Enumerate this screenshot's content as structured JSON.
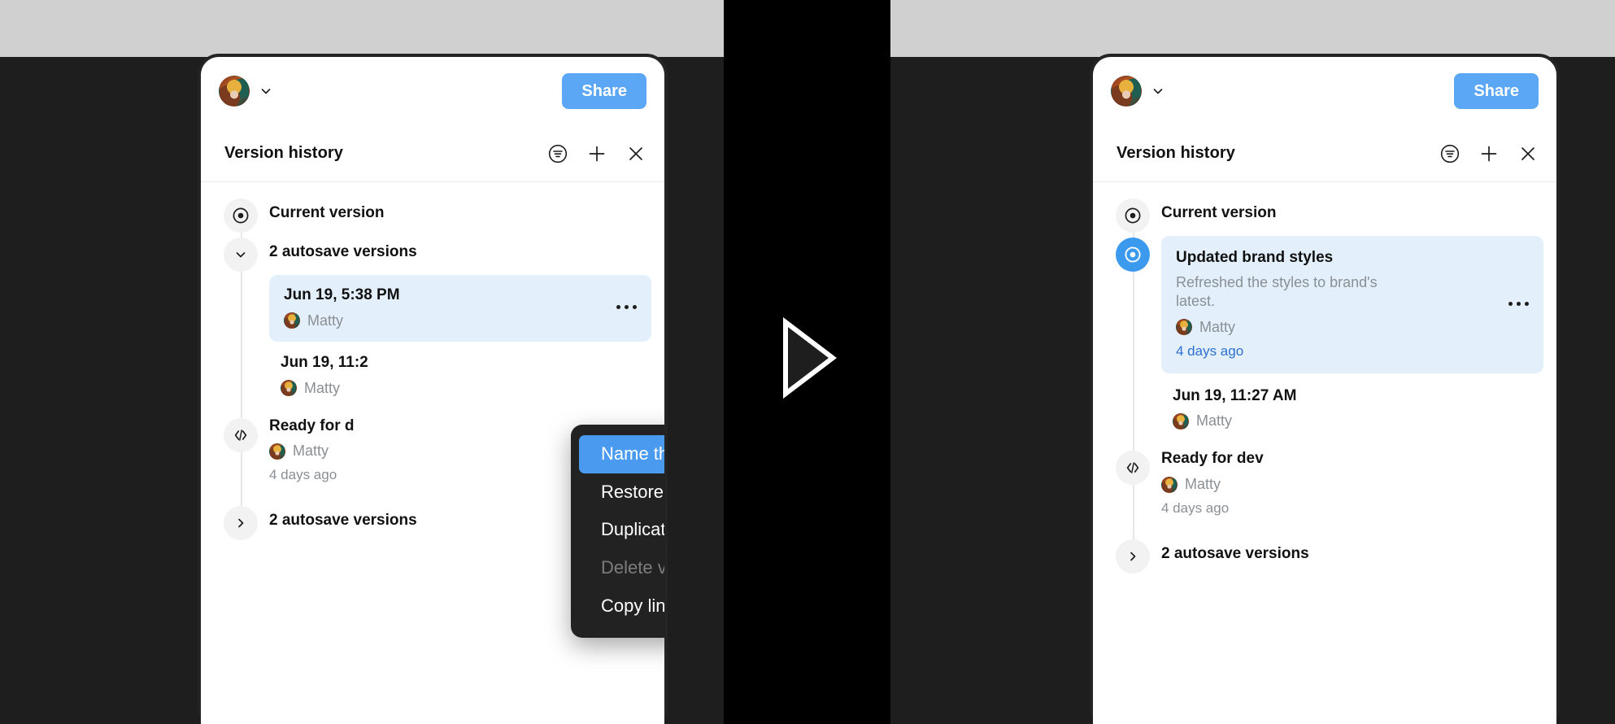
{
  "app": {
    "share_label": "Share",
    "avatar_name": "user-avatar",
    "account_chevron": "chevron-down-icon"
  },
  "panel": {
    "title": "Version history",
    "actions": [
      {
        "name": "filter-list-icon",
        "label": "Filter versions"
      },
      {
        "name": "plus-icon",
        "label": "Add version"
      },
      {
        "name": "close-icon",
        "label": "Close"
      }
    ]
  },
  "left_panel": {
    "rows": [
      {
        "kind": "current",
        "node_icon": "target-circle-icon",
        "label": "Current version"
      },
      {
        "kind": "group",
        "node_icon": "chevron-down-icon",
        "label": "2 autosave versions"
      },
      {
        "kind": "selected",
        "node_icon": "none",
        "label": "Jun 19, 5:38 PM",
        "user": "Matty",
        "menu_icon": "more-options-icon"
      },
      {
        "kind": "version",
        "node_icon": "none",
        "label": "Jun 19, 11:2",
        "user": "Matty"
      },
      {
        "kind": "dev",
        "node_icon": "code-brackets-icon",
        "label": "Ready for d",
        "user": "Matty",
        "time": "4 days ago"
      },
      {
        "kind": "group",
        "node_icon": "chevron-right-icon",
        "label": "2 autosave versions"
      }
    ]
  },
  "right_panel": {
    "rows": [
      {
        "kind": "current",
        "node_icon": "target-circle-icon",
        "label": "Current version"
      },
      {
        "kind": "selected-named",
        "node_icon": "target-circle-active-icon",
        "label": "Updated brand styles",
        "description": "Refreshed the styles to brand's latest.",
        "user": "Matty",
        "time": "4 days ago",
        "menu_icon": "more-options-icon"
      },
      {
        "kind": "version",
        "node_icon": "none",
        "label": "Jun 19, 11:27 AM",
        "user": "Matty"
      },
      {
        "kind": "dev",
        "node_icon": "code-brackets-icon",
        "label": "Ready for dev",
        "user": "Matty",
        "time": "4 days ago"
      },
      {
        "kind": "group",
        "node_icon": "chevron-right-icon",
        "label": "2 autosave versions"
      }
    ]
  },
  "context_menu": {
    "items": [
      {
        "label": "Name this version",
        "state": "selected"
      },
      {
        "label": "Restore this version",
        "state": "normal"
      },
      {
        "label": "Duplicate",
        "state": "normal"
      },
      {
        "label": "Delete version info",
        "state": "disabled"
      },
      {
        "label": "Copy link",
        "state": "normal"
      }
    ]
  },
  "media": {
    "play_icon": "play-triangle-icon"
  },
  "colors": {
    "accent_blue": "#5ca7f5",
    "menu_highlight": "#4a9bf0",
    "selection_bg": "#e3f0fb",
    "link_blue": "#2d6fd1",
    "frame_dark": "#242424",
    "backdrop_dark": "#1e1e1e",
    "backdrop_gray": "#d0d0d0"
  }
}
